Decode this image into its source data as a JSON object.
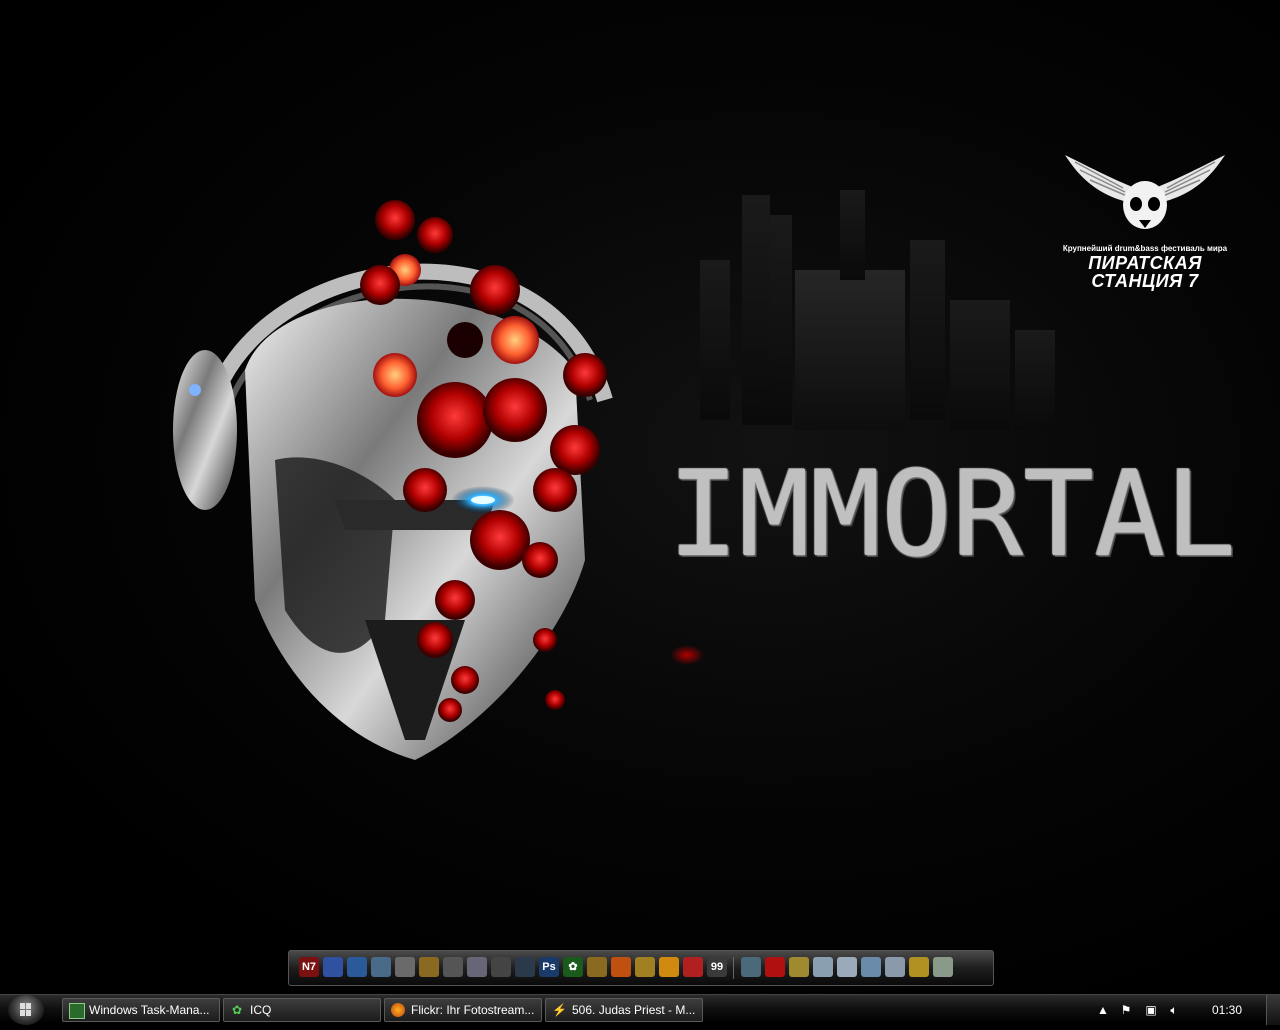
{
  "wallpaper": {
    "title": "IMMORTAL",
    "logo_tagline": "Крупнейший drum&bass фестиваль мира",
    "logo_name": "ПИРАТСКАЯ\nСТАНЦИЯ 7"
  },
  "dock": {
    "icons": [
      {
        "name": "nfs-icon",
        "label": "N7",
        "color": "#7a1010"
      },
      {
        "name": "app-blue-icon",
        "label": "",
        "color": "#3050a0"
      },
      {
        "name": "app-tcp-icon",
        "label": "",
        "color": "#2a5a9a"
      },
      {
        "name": "globe-icon",
        "label": "",
        "color": "#4a6a8a"
      },
      {
        "name": "bell-icon",
        "label": "",
        "color": "#6a6a6a"
      },
      {
        "name": "game-icon",
        "label": "",
        "color": "#8a6a20"
      },
      {
        "name": "soldier-icon",
        "label": "",
        "color": "#555"
      },
      {
        "name": "helmet-icon",
        "label": "",
        "color": "#667"
      },
      {
        "name": "wot-icon",
        "label": "",
        "color": "#444"
      },
      {
        "name": "steam-icon",
        "label": "",
        "color": "#2a3a4a"
      },
      {
        "name": "photoshop-icon",
        "label": "Ps",
        "color": "#1a3a6a"
      },
      {
        "name": "icq-icon",
        "label": "✿",
        "color": "#1a5a1a"
      },
      {
        "name": "ornament-icon",
        "label": "",
        "color": "#8a6a20"
      },
      {
        "name": "firefox-icon",
        "label": "",
        "color": "#c05010"
      },
      {
        "name": "winamp-icon",
        "label": "",
        "color": "#a08020"
      },
      {
        "name": "orb-icon",
        "label": "",
        "color": "#d08a10"
      },
      {
        "name": "red-app-icon",
        "label": "",
        "color": "#b02020"
      },
      {
        "name": "counter-icon",
        "label": "99",
        "color": "#3a3a3a"
      },
      {
        "name": "monitor-icon",
        "label": "",
        "color": "#4a6a7a"
      },
      {
        "name": "avira-icon",
        "label": "",
        "color": "#b01010"
      },
      {
        "name": "folder-icon",
        "label": "",
        "color": "#a08a30"
      },
      {
        "name": "recycle-bin-icon",
        "label": "",
        "color": "#8aa0b0"
      },
      {
        "name": "notes-icon",
        "label": "",
        "color": "#9aaabb"
      },
      {
        "name": "network-icon",
        "label": "",
        "color": "#6a8aaa"
      },
      {
        "name": "drive-icon",
        "label": "",
        "color": "#8a9aaa"
      },
      {
        "name": "tools-icon",
        "label": "",
        "color": "#b09020"
      },
      {
        "name": "scissors-icon",
        "label": "",
        "color": "#8a9a8a"
      }
    ]
  },
  "taskbar": {
    "buttons": [
      {
        "label": "Windows Task-Mana...",
        "icon": "task-manager-icon"
      },
      {
        "label": "ICQ",
        "icon": "icq-icon"
      },
      {
        "label": "Flickr: Ihr Fotostream...",
        "icon": "firefox-icon"
      },
      {
        "label": "506. Judas Priest - M...",
        "icon": "winamp-icon"
      }
    ],
    "clock": "01:30"
  }
}
